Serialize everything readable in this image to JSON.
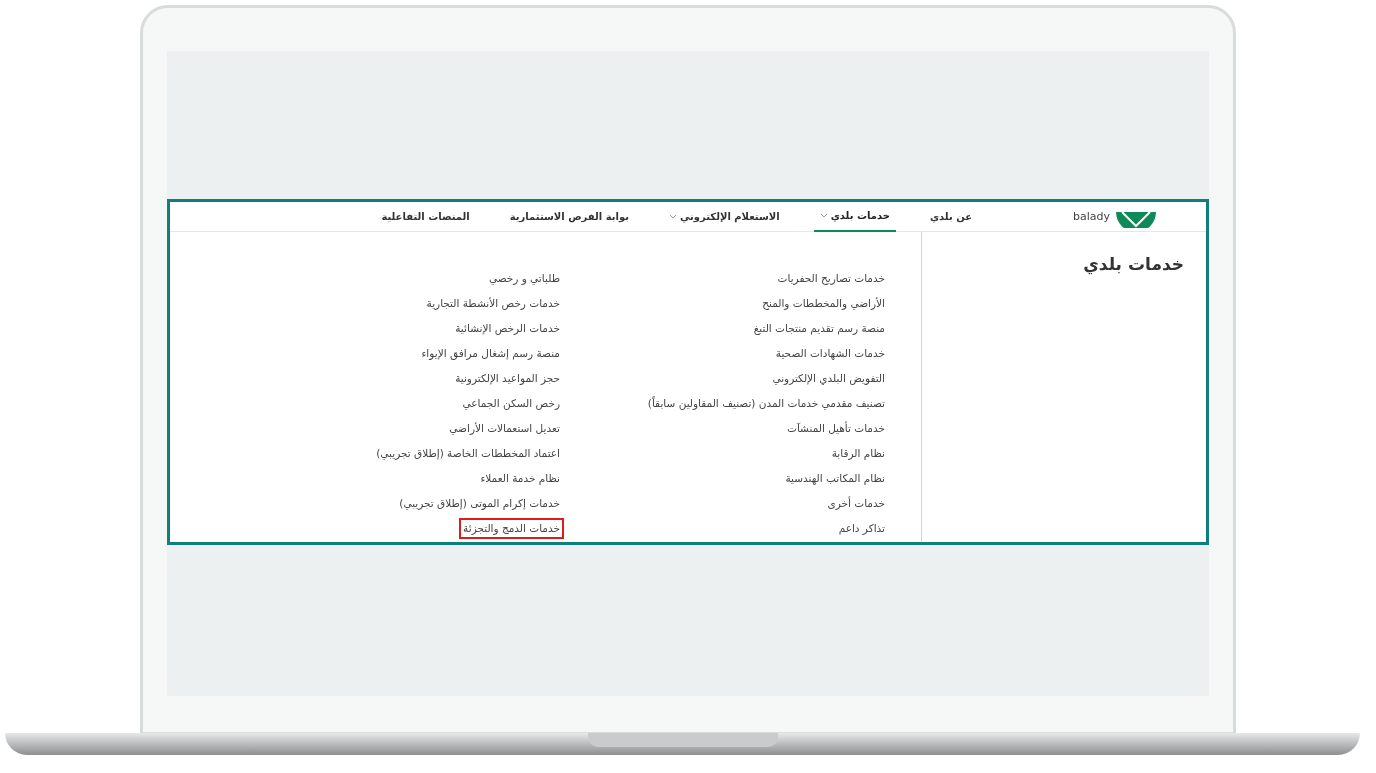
{
  "logo": {
    "text": "balady"
  },
  "nav": [
    {
      "label": "عن بلدي",
      "selected": false,
      "dropdown": false
    },
    {
      "label": "خدمات بلدي",
      "selected": true,
      "dropdown": true
    },
    {
      "label": "الاستعلام الإلكتروني",
      "selected": false,
      "dropdown": true
    },
    {
      "label": "بوابة الفرص الاستثمارية",
      "selected": false,
      "dropdown": false
    },
    {
      "label": "المنصات التفاعلية",
      "selected": false,
      "dropdown": false
    }
  ],
  "menu_title": "خدمات بلدي",
  "columns": [
    [
      {
        "label": "خدمات تصاريح الحفريات",
        "highlighted": false
      },
      {
        "label": "الأراضي والمخططات والمنح",
        "highlighted": false
      },
      {
        "label": "منصة رسم تقديم منتجات التبغ",
        "highlighted": false
      },
      {
        "label": "خدمات الشهادات الصحية",
        "highlighted": false
      },
      {
        "label": "التفويض البلدي الإلكتروني",
        "highlighted": false
      },
      {
        "label": "تصنيف مقدمي خدمات المدن (تصنيف المقاولين سابقاً)",
        "highlighted": false
      },
      {
        "label": "خدمات تأهيل المنشآت",
        "highlighted": false
      },
      {
        "label": "نظام الرقابة",
        "highlighted": false
      },
      {
        "label": "نظام المكاتب الهندسية",
        "highlighted": false
      },
      {
        "label": "خدمات أخرى",
        "highlighted": false
      },
      {
        "label": "تذاكر داعم",
        "highlighted": false
      }
    ],
    [
      {
        "label": "طلباتي و رخصي",
        "highlighted": false
      },
      {
        "label": "خدمات رخص الأنشطة التجارية",
        "highlighted": false
      },
      {
        "label": "خدمات الرخص الإنشائية",
        "highlighted": false
      },
      {
        "label": "منصة رسم إشغال مرافق الإيواء",
        "highlighted": false
      },
      {
        "label": "حجز المواعيد الإلكترونية",
        "highlighted": false
      },
      {
        "label": "رخص السكن الجماعي",
        "highlighted": false
      },
      {
        "label": "تعديل استعمالات الأراضي",
        "highlighted": false
      },
      {
        "label": "اعتماد المخططات الخاصة (إطلاق تجريبي)",
        "highlighted": false
      },
      {
        "label": "نظام خدمة العملاء",
        "highlighted": false
      },
      {
        "label": "خدمات إكرام الموتى (إطلاق تجريبي)",
        "highlighted": false
      },
      {
        "label": "خدمات الدمج والتجزئة",
        "highlighted": true
      }
    ]
  ]
}
